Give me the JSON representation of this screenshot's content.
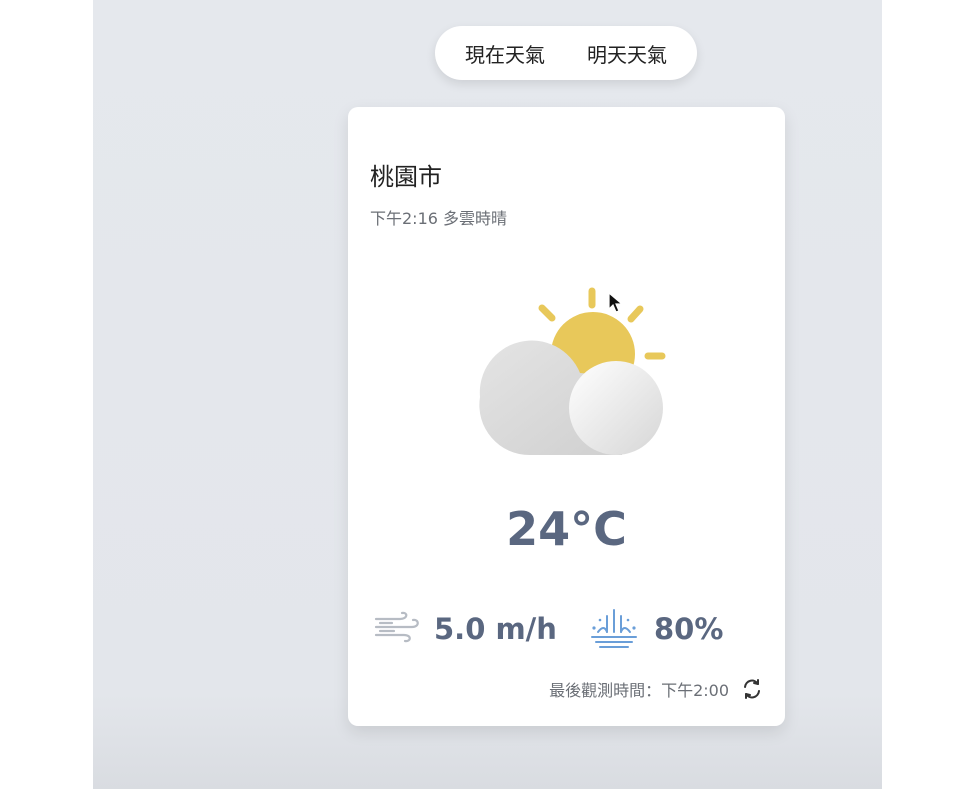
{
  "tabs": {
    "current": "現在天氣",
    "tomorrow": "明天天氣"
  },
  "weather": {
    "location": "桃園市",
    "description": "下午2:16 多雲時晴",
    "icon": "partly-cloudy-day-icon",
    "temperature": "24°C",
    "wind_speed": "5.0 m/h",
    "rain_probability": "80%",
    "observed_label": "最後觀測時間：下午2:00"
  },
  "colors": {
    "sun": "#e8c85a",
    "value_text": "#5a6780",
    "rain_icon": "#6a9ed8"
  }
}
